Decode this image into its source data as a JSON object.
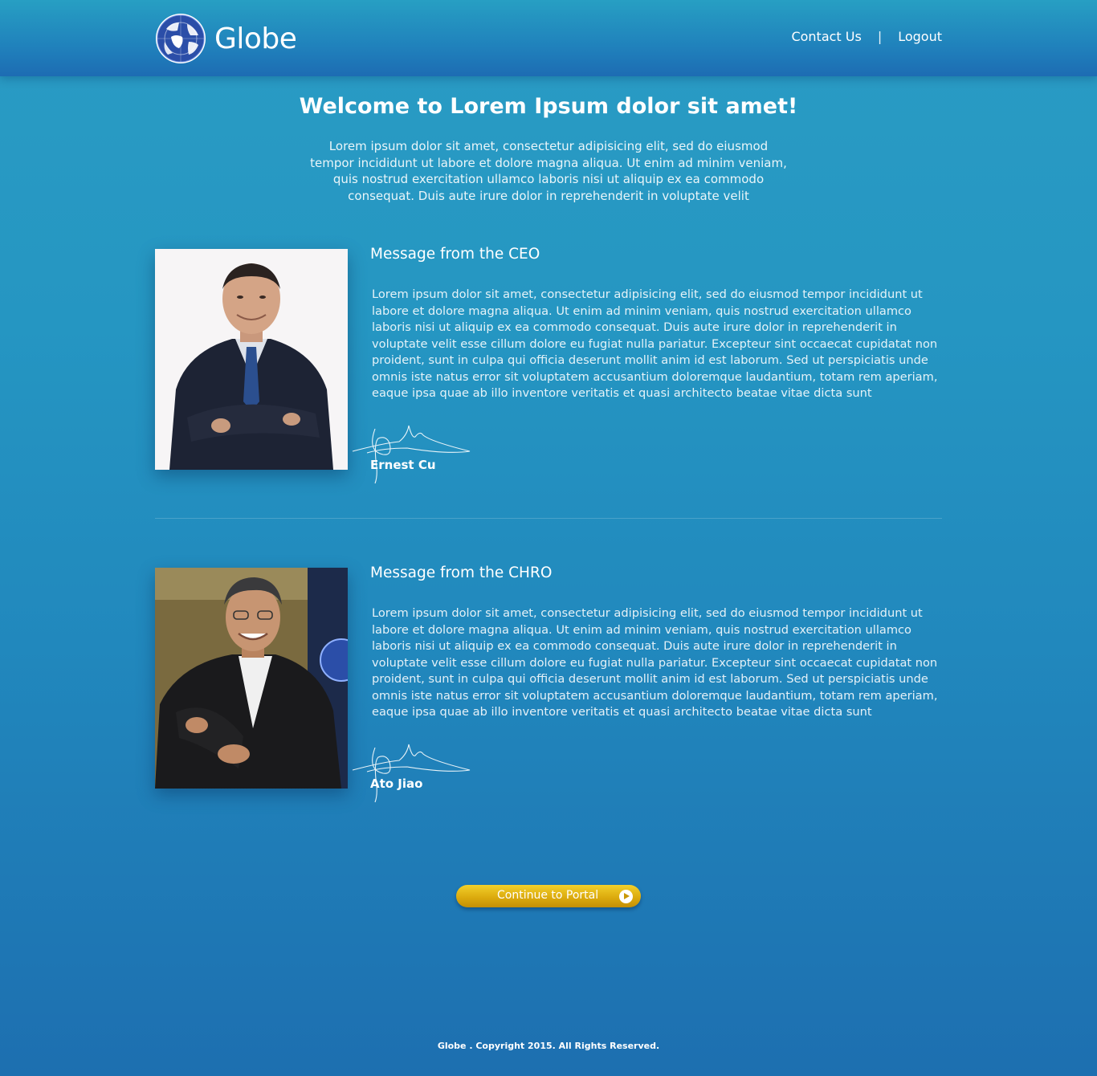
{
  "header": {
    "brand": "Globe",
    "nav": {
      "contact": "Contact Us",
      "separator": "|",
      "logout": "Logout"
    }
  },
  "intro": {
    "title": "Welcome to Lorem Ipsum dolor sit amet!",
    "text": "Lorem ipsum dolor sit amet, consectetur adipisicing elit, sed do eiusmod tempor incididunt ut labore et dolore magna aliqua. Ut enim ad minim veniam, quis nostrud exercitation ullamco laboris nisi ut aliquip ex ea commodo consequat. Duis aute irure dolor in reprehenderit in voluptate velit"
  },
  "messages": [
    {
      "title": "Message from the CEO",
      "body": "Lorem ipsum dolor sit amet, consectetur adipisicing elit, sed do eiusmod tempor incididunt ut labore et dolore magna aliqua. Ut enim ad minim veniam, quis nostrud exercitation ullamco laboris nisi ut aliquip ex ea commodo consequat. Duis aute irure dolor in reprehenderit in voluptate velit esse cillum dolore eu fugiat nulla pariatur. Excepteur sint occaecat cupidatat non proident, sunt in culpa qui officia deserunt mollit anim id est laborum. Sed ut perspiciatis unde omnis iste natus error sit voluptatem accusantium doloremque laudantium, totam rem aperiam, eaque ipsa quae ab illo inventore veritatis et quasi architecto beatae vitae dicta sunt",
      "name": "Ernest Cu"
    },
    {
      "title": "Message from the CHRO",
      "body": "Lorem ipsum dolor sit amet, consectetur adipisicing elit, sed do eiusmod tempor incididunt ut labore et dolore magna aliqua. Ut enim ad minim veniam, quis nostrud exercitation ullamco laboris nisi ut aliquip ex ea commodo consequat. Duis aute irure dolor in reprehenderit in voluptate velit esse cillum dolore eu fugiat nulla pariatur. Excepteur sint occaecat cupidatat non proident, sunt in culpa qui officia deserunt mollit anim id est laborum. Sed ut perspiciatis unde omnis iste natus error sit voluptatem accusantium doloremque laudantium, totam rem aperiam, eaque ipsa quae ab illo inventore veritatis et quasi architecto beatae vitae dicta sunt",
      "name": "Ato Jiao"
    }
  ],
  "cta": {
    "label": "Continue to Portal",
    "icon": "play-circle-icon"
  },
  "footer": {
    "copyright": "Globe . Copyright 2015. All Rights Reserved."
  },
  "colors": {
    "background_top": "#2a9cc4",
    "background_bottom": "#1d6fb0",
    "cta_gold": "#dcab0e",
    "logo_blue": "#2b4ea8"
  }
}
